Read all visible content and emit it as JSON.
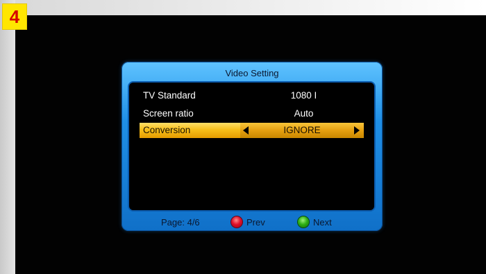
{
  "step_badge": "4",
  "dialog": {
    "title": "Video Setting",
    "rows": [
      {
        "label": "TV Standard",
        "value": "1080 I"
      },
      {
        "label": "Screen ratio",
        "value": "Auto"
      },
      {
        "label": "Conversion",
        "value": "IGNORE",
        "selected": true
      }
    ],
    "footer": {
      "page_info": "Page: 4/6",
      "prev_label": "Prev",
      "next_label": "Next"
    }
  },
  "icons": {
    "left_arrow": "arrow-left-icon",
    "right_arrow": "arrow-right-icon",
    "red_button": "red-button-icon",
    "green_button": "green-button-icon"
  },
  "colors": {
    "dialog_blue": "#1f8fe6",
    "highlight_yellow": "#f7bf1a",
    "badge_yellow": "#ffe600",
    "badge_text": "#d60000"
  }
}
